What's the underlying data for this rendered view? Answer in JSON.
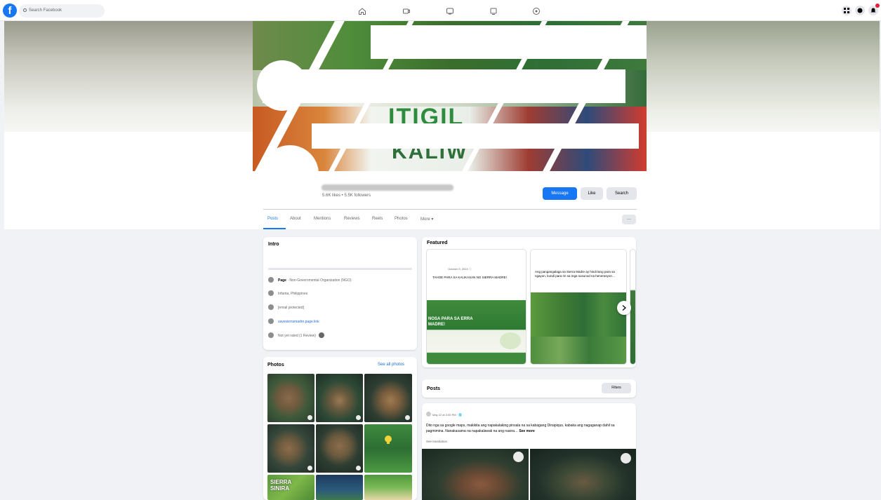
{
  "topbar": {
    "logo": "f",
    "search_placeholder": "Search Facebook",
    "nav_icons": [
      "home-icon",
      "video-icon",
      "marketplace-icon",
      "gaming-icon",
      "groups-icon"
    ],
    "right_icons": [
      "menu-grid-icon",
      "messenger-icon",
      "notifications-icon"
    ]
  },
  "page": {
    "meta": "5.6K likes • 5.5K followers",
    "buttons": {
      "message": "Message",
      "like": "Like",
      "search": "Search"
    },
    "tabs": [
      "Posts",
      "About",
      "Mentions",
      "Reviews",
      "Reels",
      "Photos",
      "More ▾"
    ],
    "more_button": "···"
  },
  "intro": {
    "title": "Intro",
    "rows": {
      "category_label": "Page",
      "category": " · Non-Governmental Organization (NGO)",
      "location": "Infanta, Philippines",
      "email": "[email protected]",
      "website": "savesierramadre.page.link",
      "rating": "Not yet rated (1 Review)"
    }
  },
  "photos": {
    "title": "Photos",
    "see_all": "See all photos",
    "overlay_text": "SIERRA SINIRA"
  },
  "featured": {
    "title": "Featured",
    "item1": {
      "date": "October 5, 2024 ⓘ",
      "text": "TAHOE PARA SA KALIKASAN NG SIERRA MADRE!",
      "banner": "NOSA PARA SA ERRA MADRE!"
    },
    "item2": {
      "text": "Ang pangangalaga sa Sierra Madre ay hindi lang para sa ngayon, kundi para rin sa mga susunod na henerasyon…"
    }
  },
  "posts": {
    "title": "Posts",
    "filters": "Filters",
    "meta": "May 22 at 3:05 PM · 🌐",
    "text": "Dito nga sa google maps, makikita ang napakalaking pinsala na sa kabagang Dinapiqus, kabaka ang nagaganap dahil sa pagmimina. Nanakasama na napakalawak na ang nasira…",
    "see_more": "See more",
    "see_translation": "See translation"
  },
  "colors": {
    "brand": "#1877f2",
    "background": "#f0f2f5",
    "cover_green": "#2d6a2f"
  }
}
